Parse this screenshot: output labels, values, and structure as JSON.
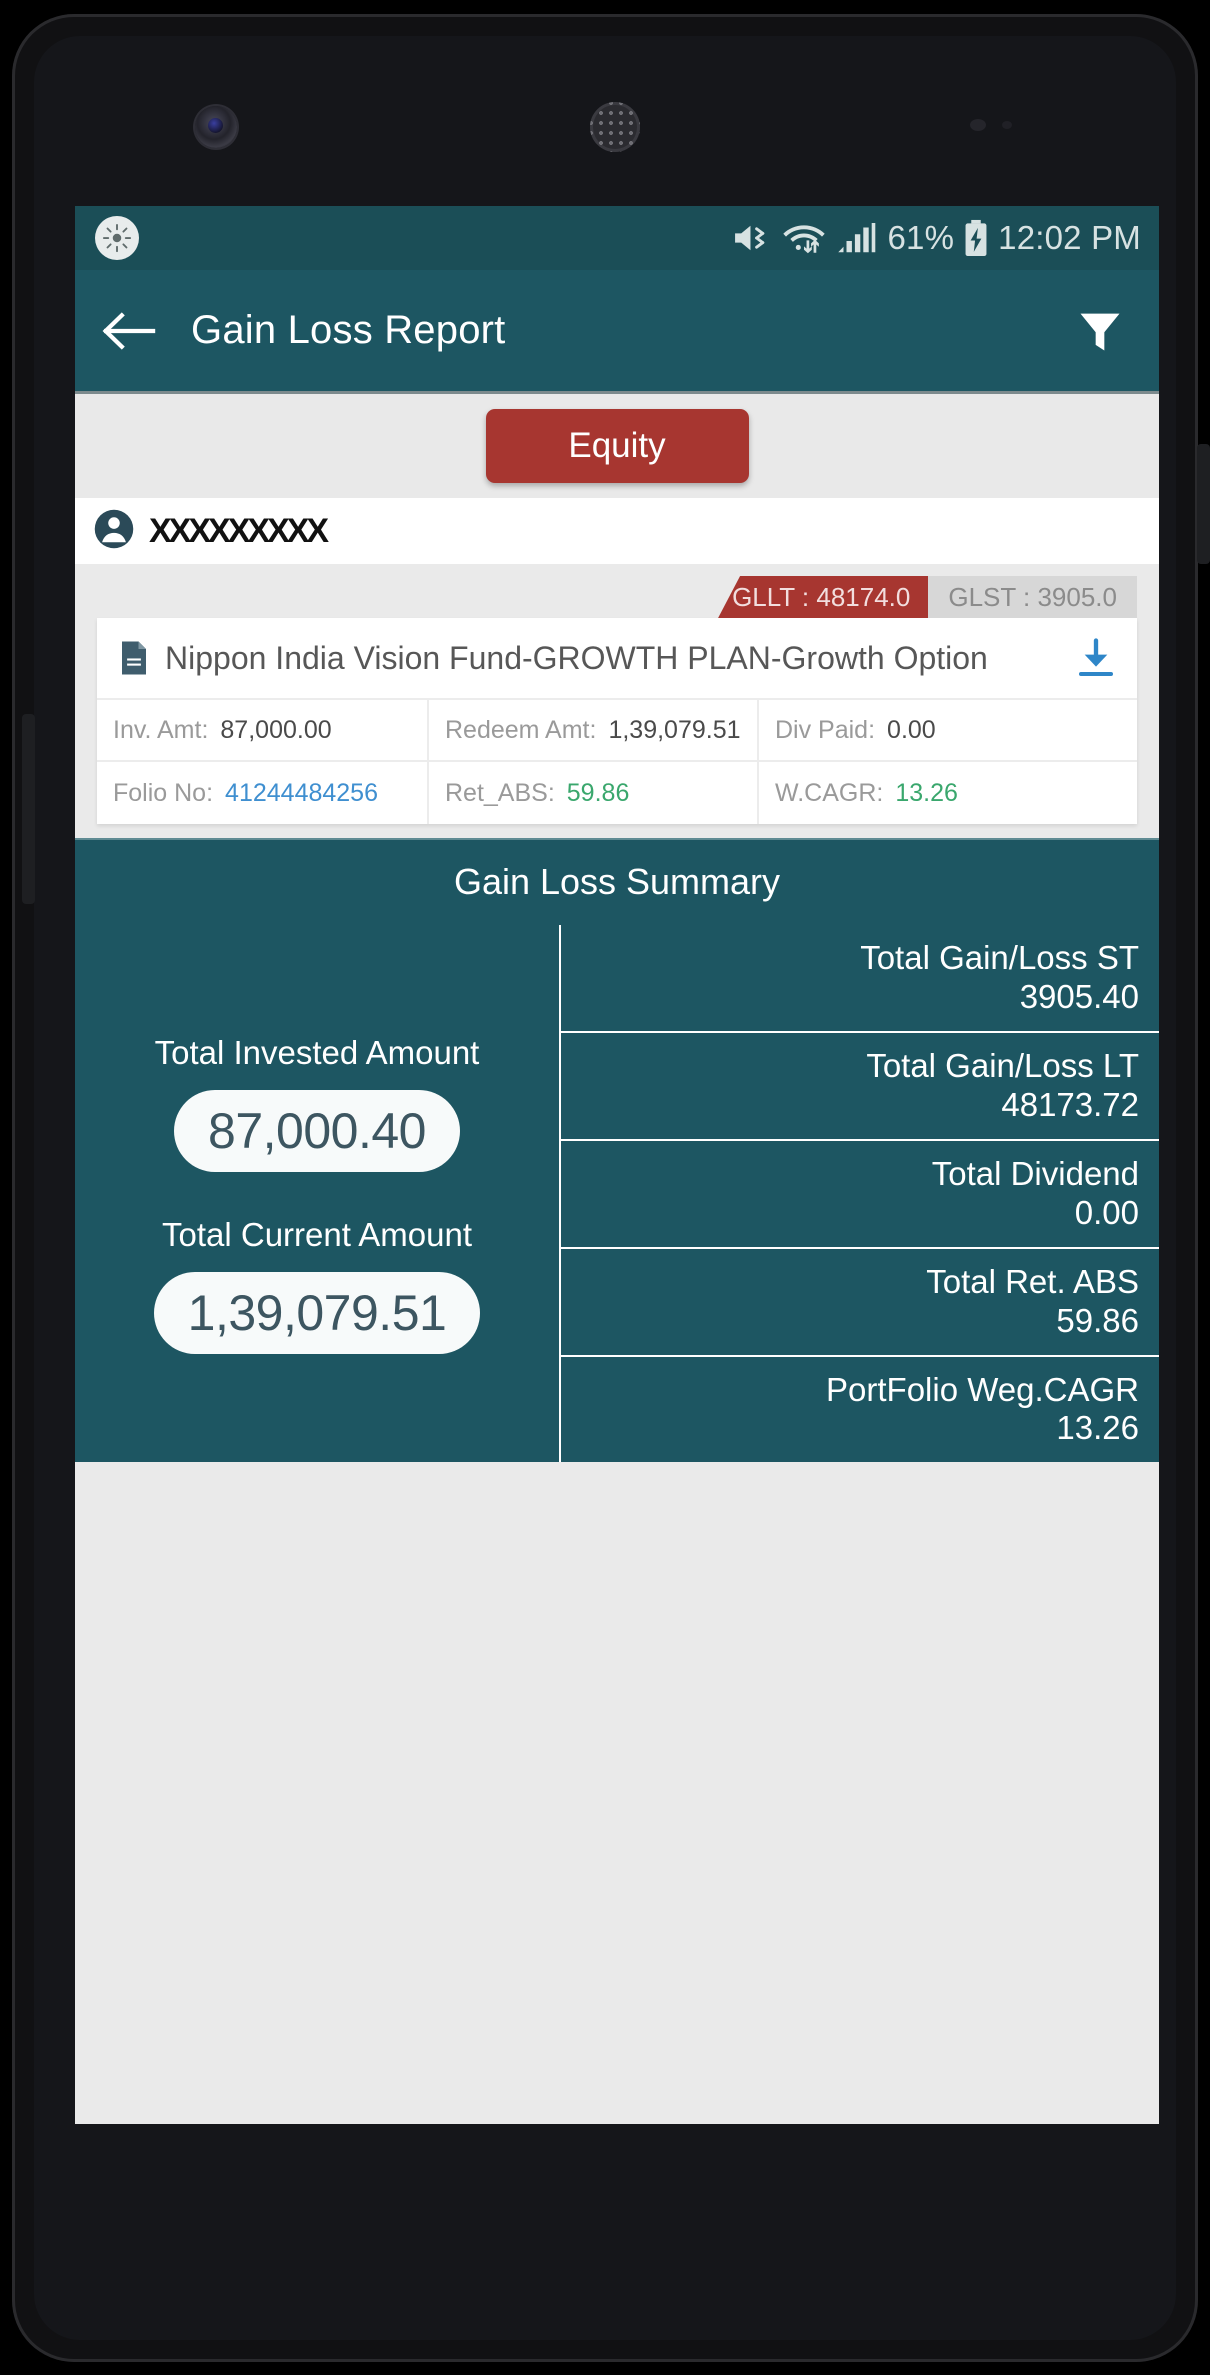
{
  "status_bar": {
    "brightness_icon": "brightness-icon",
    "mute_icon": "volume-mute-icon",
    "wifi_icon": "wifi-transfer-icon",
    "signal_icon": "cellular-signal-icon",
    "battery_percent": "61%",
    "battery_icon": "battery-charging-icon",
    "time": "12:02 PM"
  },
  "app_bar": {
    "back_icon": "back-arrow-icon",
    "title": "Gain Loss Report",
    "filter_icon": "filter-icon"
  },
  "tabs": {
    "active_label": "Equity"
  },
  "investor": {
    "avatar_icon": "person-avatar-icon",
    "name": "XXXXXXXXX"
  },
  "fund_card": {
    "badges": [
      {
        "label": "GLLT : 48174.0",
        "style": "active",
        "color": "#a73630"
      },
      {
        "label": "GLST : 3905.0",
        "style": "inactive",
        "color": "#d7d7d7"
      }
    ],
    "doc_icon": "document-icon",
    "download_icon": "download-icon",
    "name": "Nippon India Vision Fund-GROWTH PLAN-Growth Option",
    "rows": [
      [
        {
          "label": "Inv. Amt:",
          "value": "87,000.00",
          "value_color": "#4a4a4a"
        },
        {
          "label": "Redeem Amt:",
          "value": "1,39,079.51",
          "value_color": "#4a4a4a"
        },
        {
          "label": "Div Paid:",
          "value": "0.00",
          "value_color": "#4a4a4a"
        }
      ],
      [
        {
          "label": "Folio No:",
          "value": "41244484256",
          "value_color": "#3f8fd0"
        },
        {
          "label": "Ret_ABS:",
          "value": "59.86",
          "value_color": "#3aa76d"
        },
        {
          "label": "W.CAGR:",
          "value": "13.26",
          "value_color": "#3aa76d"
        }
      ]
    ]
  },
  "summary": {
    "title": "Gain Loss Summary",
    "left": [
      {
        "label": "Total Invested Amount",
        "value": "87,000.40"
      },
      {
        "label": "Total Current Amount",
        "value": "1,39,079.51"
      }
    ],
    "right": [
      {
        "label": "Total Gain/Loss ST",
        "value": "3905.40"
      },
      {
        "label": "Total Gain/Loss LT",
        "value": "48173.72"
      },
      {
        "label": "Total Dividend",
        "value": "0.00"
      },
      {
        "label": "Total Ret. ABS",
        "value": "59.86"
      },
      {
        "label": "PortFolio Weg.CAGR",
        "value": "13.26"
      }
    ]
  },
  "theme": {
    "app_bar_teal": "#1d5662",
    "status_bar_teal": "#1b4e57",
    "accent_red": "#a73630",
    "page_grey": "#eaeaea",
    "link_blue": "#3f8fd0",
    "positive_green": "#3aa76d"
  }
}
